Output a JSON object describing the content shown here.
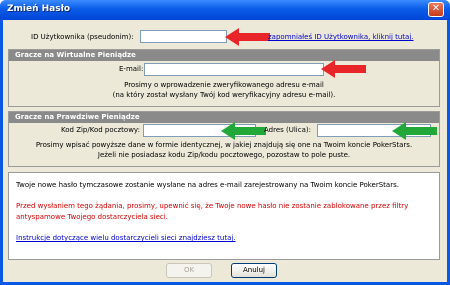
{
  "window": {
    "title": "Zmień Hasło"
  },
  "user_id": {
    "label": "ID Użytkownika (pseudonim):",
    "value": "",
    "forgot_link": "zapomniałeś ID Użytkownika, kliknij tutaj."
  },
  "play_money": {
    "heading": "Gracze na Wirtualne Pieniądze",
    "email_label": "E-mail:",
    "email_value": "",
    "note_line1": "Prosimy o wprowadzenie zweryfikowanego adresu e-mail",
    "note_line2": "(na który został wysłany Twój kod weryfikacyjny adresu e-mail)."
  },
  "real_money": {
    "heading": "Gracze na Prawdziwe Pieniądze",
    "zip_label": "Kod Zip/Kod pocztowy:",
    "zip_value": "",
    "address_label": "Adres (Ulica):",
    "address_value": "",
    "note_line1": "Prosimy wpisać powyższe dane w formie identycznej, w jakiej znajdują się one na Twoim koncie PokerStars.",
    "note_line2": "Jeżeli nie posiadasz kodu Zip/kodu pocztowego, pozostaw to pole puste."
  },
  "info": {
    "line1": "Twoje nowe hasło tymczasowe zostanie wysłane na adres e-mail zarejestrowany na Twoim koncie PokerStars.",
    "warning_line1": "Przed wysłaniem tego żądania, prosimy, upewnić się, że Twoje nowe hasło nie zostanie zablokowane przez filtry",
    "warning_line2": "antyspamowe Twojego dostarczyciela sieci.",
    "link": "Instrukcje dotyczące wielu dostarczycieli sieci znajdziesz tutaj."
  },
  "buttons": {
    "ok": "OK",
    "cancel": "Anuluj"
  },
  "colors": {
    "arrow_red": "#e8262a",
    "arrow_green": "#22a838",
    "warning": "#d40000",
    "link": "#0000cc"
  }
}
